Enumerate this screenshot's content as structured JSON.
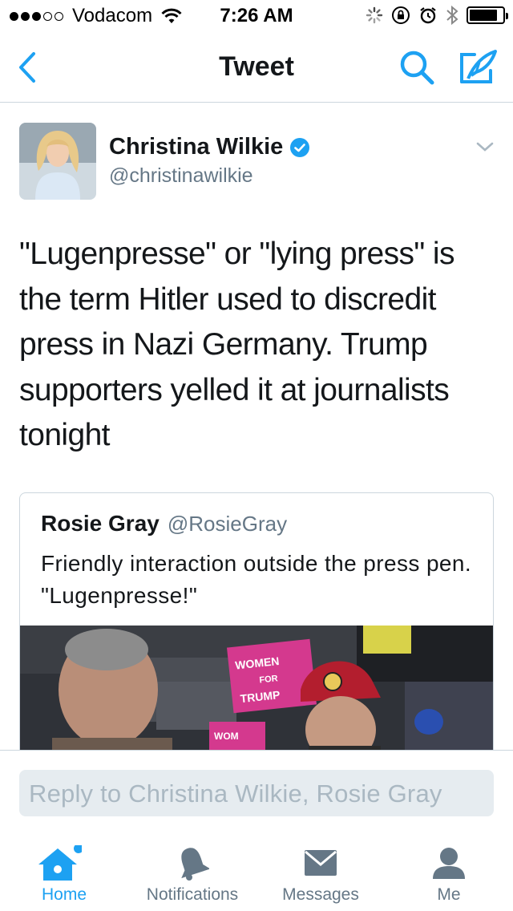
{
  "status_bar": {
    "carrier": "Vodacom",
    "time": "7:26 AM",
    "signal_bars_filled": 3,
    "signal_bars_total": 5,
    "battery_level": 0.85
  },
  "nav": {
    "title": "Tweet",
    "back_icon": "chevron-left-icon",
    "search_icon": "search-icon",
    "compose_icon": "compose-icon"
  },
  "tweet": {
    "author_name": "Christina Wilkie",
    "author_handle": "@christinawilkie",
    "verified": true,
    "text": "\"Lugenpresse\" or \"lying press\" is the term Hitler used to discredit press in Nazi Germany. Trump supporters yelled it at journalists tonight",
    "quoted": {
      "author_name": "Rosie Gray",
      "author_handle": "@RosieGray",
      "text": "Friendly interaction outside the press pen. \"Lugenpresse!\"",
      "media_sign_text": "WOMEN FOR TRUMP"
    }
  },
  "reply": {
    "placeholder": "Reply to Christina Wilkie, Rosie Gray"
  },
  "tabs": [
    {
      "label": "Home",
      "icon": "home-icon",
      "active": true
    },
    {
      "label": "Notifications",
      "icon": "bell-icon",
      "active": false
    },
    {
      "label": "Messages",
      "icon": "envelope-icon",
      "active": false
    },
    {
      "label": "Me",
      "icon": "person-icon",
      "active": false
    }
  ],
  "colors": {
    "accent": "#1da1f2",
    "text_primary": "#14171a",
    "text_secondary": "#657786",
    "border": "#ccd6dd",
    "reply_bg": "#e6ecf0",
    "reply_placeholder": "#aab8c2"
  }
}
